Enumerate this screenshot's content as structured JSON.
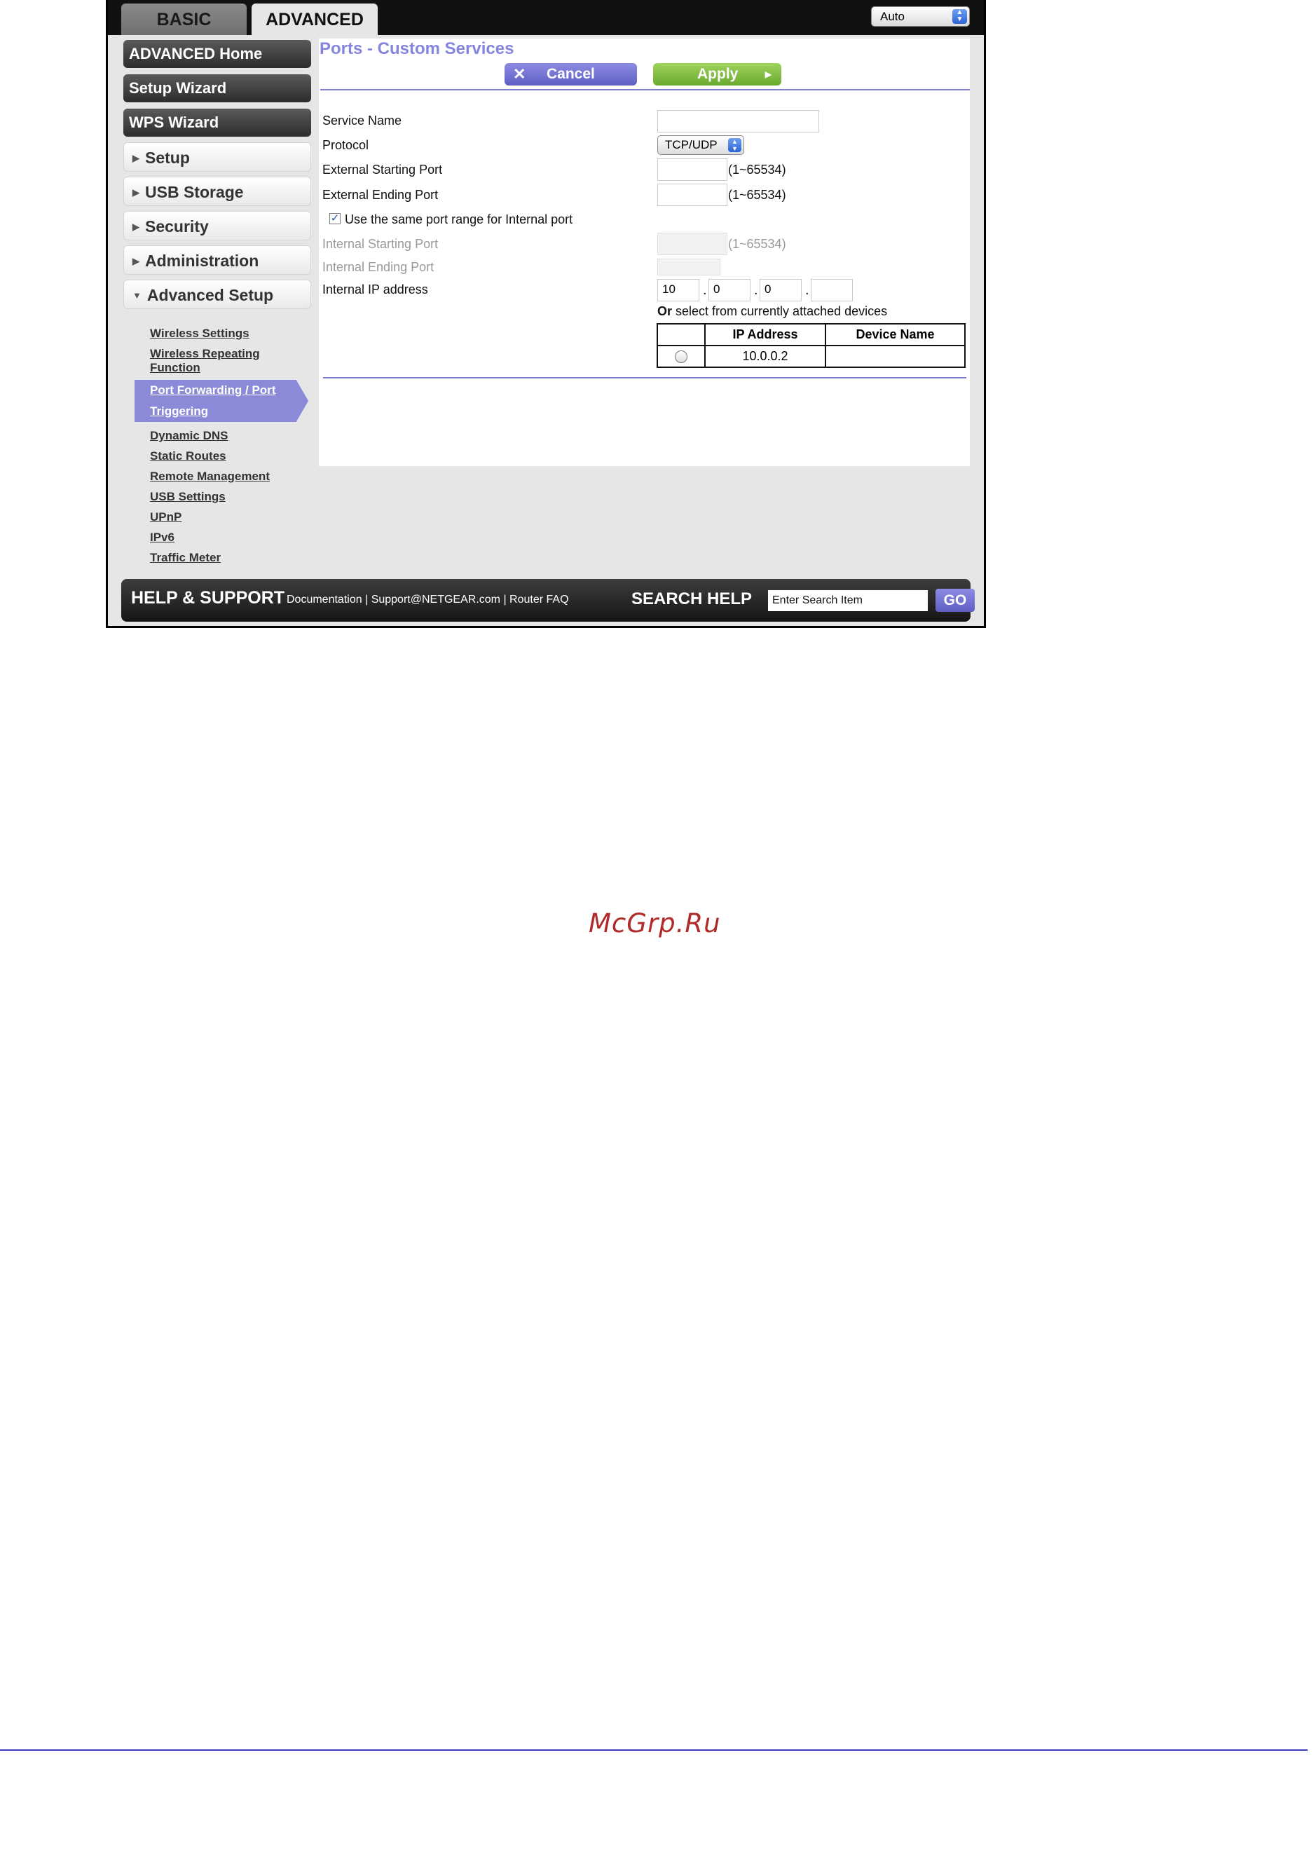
{
  "tabs": {
    "basic": "BASIC",
    "advanced": "ADVANCED"
  },
  "language_select": {
    "value": "Auto"
  },
  "sidebar": {
    "main_items": [
      {
        "label": "ADVANCED Home"
      },
      {
        "label": "Setup Wizard"
      },
      {
        "label": "WPS Wizard"
      }
    ],
    "sections": [
      {
        "label": "Setup"
      },
      {
        "label": "USB Storage"
      },
      {
        "label": "Security"
      },
      {
        "label": "Administration"
      },
      {
        "label": "Advanced Setup"
      }
    ],
    "advanced_setup_items": [
      {
        "label": "Wireless Settings"
      },
      {
        "label": "Wireless Repeating Function"
      },
      {
        "label": "Port Forwarding / Port Triggering"
      },
      {
        "label": "Dynamic DNS"
      },
      {
        "label": "Static Routes"
      },
      {
        "label": "Remote Management"
      },
      {
        "label": "USB Settings"
      },
      {
        "label": "UPnP"
      },
      {
        "label": "IPv6"
      },
      {
        "label": "Traffic Meter"
      }
    ],
    "active_item_lines": [
      "Port Forwarding / Port",
      "Triggering"
    ],
    "wireless_repeating_lines": [
      "Wireless Repeating",
      "Function"
    ]
  },
  "content": {
    "title": "Ports - Custom Services",
    "cancel_label": "Cancel",
    "apply_label": "Apply",
    "fields": {
      "service_name": {
        "label": "Service Name",
        "value": ""
      },
      "protocol": {
        "label": "Protocol",
        "value": "TCP/UDP"
      },
      "ext_start": {
        "label": "External Starting Port",
        "value": "",
        "range": "(1~65534)"
      },
      "ext_end": {
        "label": "External Ending Port",
        "value": "",
        "range": "(1~65534)"
      },
      "same_range": {
        "label": "Use the same port range for Internal port",
        "checked": true
      },
      "int_start": {
        "label": "Internal Starting Port",
        "value": "",
        "range": "(1~65534)"
      },
      "int_end": {
        "label": "Internal Ending Port",
        "value": ""
      },
      "ip": {
        "label": "Internal IP address",
        "octets": [
          "10",
          "0",
          "0",
          ""
        ]
      }
    },
    "or_select_bold": "Or",
    "or_select_rest": " select from currently attached devices",
    "device_table": {
      "headers": [
        "",
        "IP Address",
        "Device Name"
      ],
      "rows": [
        {
          "ip": "10.0.0.2",
          "name": ""
        }
      ]
    }
  },
  "footer": {
    "help_title": "HELP & SUPPORT",
    "links": [
      "Documentation",
      "Support@NETGEAR.com",
      "Router FAQ"
    ],
    "search_title": "SEARCH HELP",
    "search_value": "Enter Search Item",
    "go_label": "GO"
  },
  "page": {
    "watermark": "McGrp.Ru"
  },
  "colors": {
    "accent_purple": "#8585e0",
    "apply_green": "#7fbe3f",
    "rule_blue": "#3b3bbb"
  }
}
